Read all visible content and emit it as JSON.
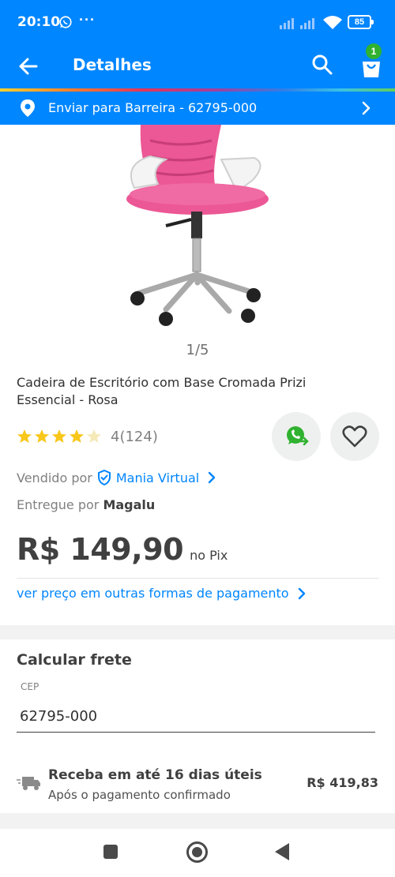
{
  "statusbar": {
    "time": "20:10",
    "dots": "···",
    "battery": "85"
  },
  "appbar": {
    "title": "Detalhes",
    "cart_count": "1"
  },
  "delivery": {
    "text": "Enviar para Barreira - 62795-000"
  },
  "product": {
    "pager": "1/5",
    "title": "Cadeira de Escritório com Base Cromada Prizi Essencial - Rosa",
    "rating_text": "4(124)",
    "rating_value": 4,
    "rating_max": 5,
    "seller_prefix": "Vendido por",
    "seller_name": "Mania Virtual",
    "delivered_prefix": "Entregue por",
    "delivered_by": "Magalu",
    "price": "R$ 149,90",
    "price_note": "no Pix",
    "other_payment": "ver preço em outras formas de pagamento"
  },
  "shipping": {
    "title": "Calcular frete",
    "cep_label": "CEP",
    "cep_value": "62795-000",
    "option_title": "Receba em até 16 dias úteis",
    "option_sub": "Após o pagamento confirmado",
    "option_cost": "R$ 419,83"
  },
  "colors": {
    "brand_blue": "#0086ff",
    "star_yellow": "#f8c71b",
    "whatsapp_green": "#30b230"
  }
}
